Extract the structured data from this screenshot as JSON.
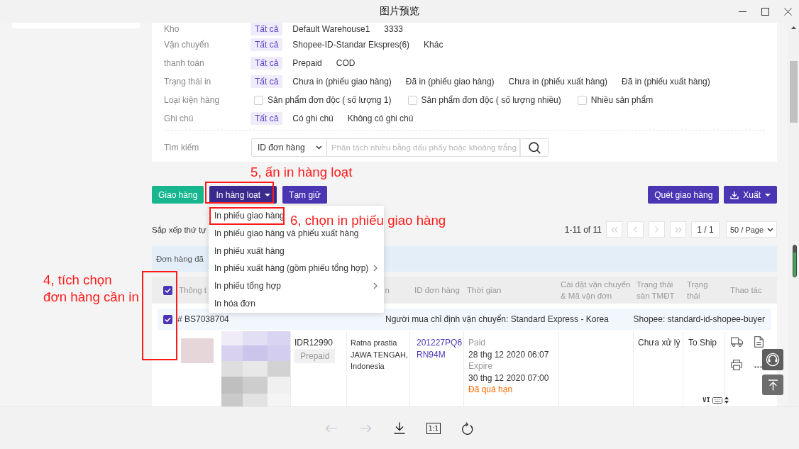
{
  "window": {
    "title": "图片预览"
  },
  "page": {
    "filters": [
      {
        "label": "Kho",
        "kind": "tags",
        "options": [
          {
            "label": "Tất cả",
            "selected": true
          },
          {
            "label": "Default Warehouse1",
            "selected": false
          },
          {
            "label": "3333",
            "selected": false
          }
        ]
      },
      {
        "label": "Vận chuyển",
        "kind": "tags",
        "options": [
          {
            "label": "Tất cả",
            "selected": true
          },
          {
            "label": "Shopee-ID-Standar Ekspres(6)",
            "selected": false
          },
          {
            "label": "Khác",
            "selected": false
          }
        ]
      },
      {
        "label": "thanh toán",
        "kind": "tags",
        "options": [
          {
            "label": "Tất cả",
            "selected": true
          },
          {
            "label": "Prepaid",
            "selected": false
          },
          {
            "label": "COD",
            "selected": false
          }
        ]
      },
      {
        "label": "Trạng thái in",
        "kind": "tags",
        "options": [
          {
            "label": "Tất cả",
            "selected": true
          },
          {
            "label": "Chưa in (phiếu giao hàng)",
            "selected": false
          },
          {
            "label": "Đã in (phiếu giao hàng)",
            "selected": false
          },
          {
            "label": "Chưa in (phiếu xuất hàng)",
            "selected": false
          },
          {
            "label": "Đã in (phiếu xuất hàng)",
            "selected": false
          }
        ]
      },
      {
        "label": "Loại kiện hàng",
        "kind": "checkboxes",
        "options": [
          {
            "label": "Sản phẩm đơn độc ( số lượng 1)",
            "checked": false
          },
          {
            "label": "Sản phẩm đơn độc ( số lượng nhiều)",
            "checked": false
          },
          {
            "label": "Nhiều sản phẩm",
            "checked": false
          }
        ]
      },
      {
        "label": "Ghi chú",
        "kind": "tags",
        "options": [
          {
            "label": "Tất cả",
            "selected": true
          },
          {
            "label": "Có ghi chú",
            "selected": false
          },
          {
            "label": "Không có ghi chú",
            "selected": false
          }
        ]
      }
    ],
    "search": {
      "label": "Tìm kiếm",
      "search_by": "ID đơn hàng",
      "placeholder": "Phân tách nhiều bằng dấu phẩy hoặc khoảng trắng."
    },
    "actions_left": [
      {
        "label": "Giao hàng",
        "kind": "success"
      },
      {
        "label": "In hàng loạt",
        "kind": "menu"
      },
      {
        "label": "Tạm giữ",
        "kind": "primary"
      }
    ],
    "actions_right": [
      {
        "label": "Quét giao hàng",
        "kind": "primary"
      },
      {
        "label": "Xuất",
        "kind": "export"
      }
    ],
    "bulk_print_menu": [
      {
        "label": "In phiếu giao hàng",
        "has_submenu": false
      },
      {
        "label": "In phiếu giao hàng và phiếu xuất hàng",
        "has_submenu": false
      },
      {
        "label": "In phiếu xuất hàng",
        "has_submenu": false
      },
      {
        "label": "In phiếu xuất hàng (gồm phiếu tổng hợp)",
        "has_submenu": true
      },
      {
        "label": "In phiếu tổng hợp",
        "has_submenu": true
      },
      {
        "label": "In hóa đơn",
        "has_submenu": false
      }
    ],
    "sort_label": "Sắp xếp thứ tự",
    "pagination": {
      "range": "1-11 of 11",
      "nav_disabled": true,
      "page": "1 / 1",
      "page_size": "50 / Page"
    },
    "notice": "Đơn hàng đã",
    "table": {
      "all_checked": true,
      "columns": [
        "Thông t",
        "n",
        "ID đơn hàng",
        "Thời gian",
        "Cài đặt vận chuyển\n& Mã vận đơn",
        "Trạng thái\nsàn TMĐT",
        "Trạng\nthái",
        "Thao tác"
      ],
      "orders": [
        {
          "checked": true,
          "order_no": "# BS7038704",
          "shipping_note": "Người mua chỉ định vận chuyển: Standard Express - Korea",
          "buyer": "Shopee: standard-id-shopee-buyer",
          "amount": "IDR12990",
          "payment_tag": "Prepaid",
          "address": "Ratna prastia\nJAWA TENGAH,\nIndonesia",
          "order_id": "201227PQ6RN94M",
          "paid_label": "Paid",
          "paid_time": "28 thg 12 2020 06:07",
          "expire_label": "Expire",
          "expire_time": "30 thg 12 2020 07:00",
          "deadline": "Đã quá hạn",
          "platform_status": "Chưa xử lý",
          "status": "To Ship"
        }
      ]
    },
    "ime_indicator": "VI"
  },
  "annotations": [
    {
      "text": "5, ấn in hàng loạt"
    },
    {
      "text": "6, chọn in phiếu giao hàng"
    },
    {
      "text": "4, tích chọn\nđơn hàng cần in"
    }
  ],
  "viewer_toolbar": [
    {
      "kind": "previous",
      "disabled": true
    },
    {
      "kind": "next",
      "disabled": true
    },
    {
      "kind": "download",
      "disabled": false
    },
    {
      "kind": "actual-size",
      "label": "1:1",
      "disabled": false
    },
    {
      "kind": "rotate",
      "disabled": false
    }
  ]
}
